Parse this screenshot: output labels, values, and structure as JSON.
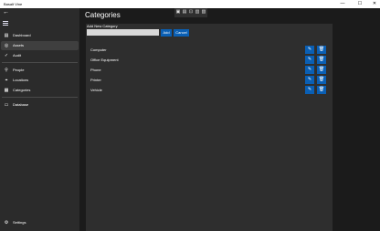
{
  "window": {
    "title": "Basalt Vine",
    "minimize_glyph": "—",
    "maximize_glyph": "☐",
    "close_glyph": "✕"
  },
  "nav": {
    "back_glyph": "←",
    "items": [
      {
        "label": "Dashboard",
        "icon": "dashboard-icon",
        "glyph": "▤"
      },
      {
        "label": "Assets",
        "icon": "assets-icon",
        "glyph": "◎"
      },
      {
        "label": "Audit",
        "icon": "audit-icon",
        "glyph": "✓"
      },
      {
        "label": "People",
        "icon": "people-icon",
        "glyph": "⚲"
      },
      {
        "label": "Locations",
        "icon": "location-icon",
        "glyph": "⌖"
      },
      {
        "label": "Categories",
        "icon": "categories-icon",
        "glyph": "▦"
      },
      {
        "label": "Database",
        "icon": "database-icon",
        "glyph": "▭"
      }
    ],
    "settings": {
      "label": "Settings",
      "icon": "gear-icon",
      "glyph": "⚙"
    }
  },
  "toolbar": {
    "icons": [
      {
        "name": "toolbar-icon-1",
        "glyph": "▣"
      },
      {
        "name": "toolbar-icon-2",
        "glyph": "▤"
      },
      {
        "name": "toolbar-icon-3",
        "glyph": "⊡"
      },
      {
        "name": "toolbar-icon-4",
        "glyph": "▥"
      },
      {
        "name": "toolbar-icon-5",
        "glyph": "▧"
      }
    ]
  },
  "page": {
    "title": "Categories"
  },
  "add_category": {
    "label": "Add New Category",
    "input_value": "",
    "add_label": "Add",
    "cancel_label": "Cancel"
  },
  "categories": [
    {
      "name": "Computer"
    },
    {
      "name": "Office Equipment"
    },
    {
      "name": "Phone"
    },
    {
      "name": "Printer"
    },
    {
      "name": "Vehicle"
    }
  ],
  "row_actions": {
    "edit_icon": "pencil-icon",
    "edit_glyph": "✎",
    "delete_icon": "trash-icon",
    "delete_glyph": "🗑"
  },
  "colors": {
    "accent": "#0a5fb4",
    "background": "#1b1b1b",
    "nav_background": "#2b2b2b",
    "panel": "#2e2e2e"
  }
}
